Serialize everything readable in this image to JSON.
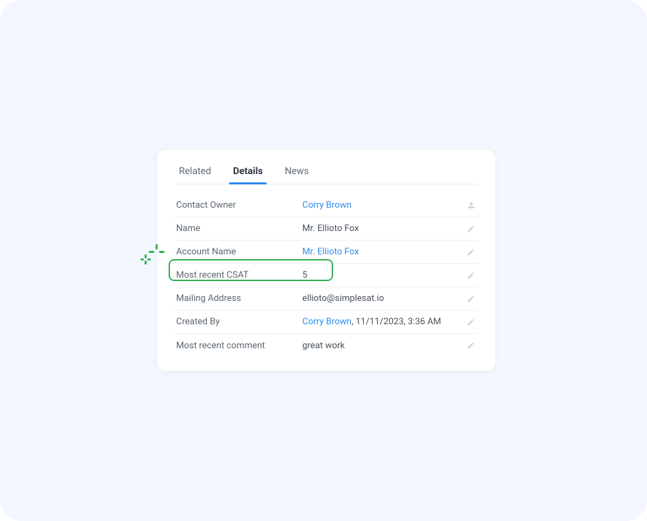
{
  "tabs": {
    "related": "Related",
    "details": "Details",
    "news": "News",
    "active": "details"
  },
  "fields": {
    "contact_owner": {
      "label": "Contact Owner",
      "value": "Corry Brown"
    },
    "name": {
      "label": "Name",
      "value": "Mr. Ellioto Fox"
    },
    "account_name": {
      "label": "Account Name",
      "value": "Mr. Ellioto Fox"
    },
    "most_recent_csat": {
      "label": "Most recent CSAT",
      "value": "5"
    },
    "mailing_address": {
      "label": "Mailing Address",
      "value": "ellioto@simplesat.io"
    },
    "created_by": {
      "label": "Created By",
      "link": "Corry Brown",
      "rest": ", 11/11/2023, 3:36 AM"
    },
    "most_recent_comment": {
      "label": "Most recent comment",
      "value": "great work"
    }
  }
}
